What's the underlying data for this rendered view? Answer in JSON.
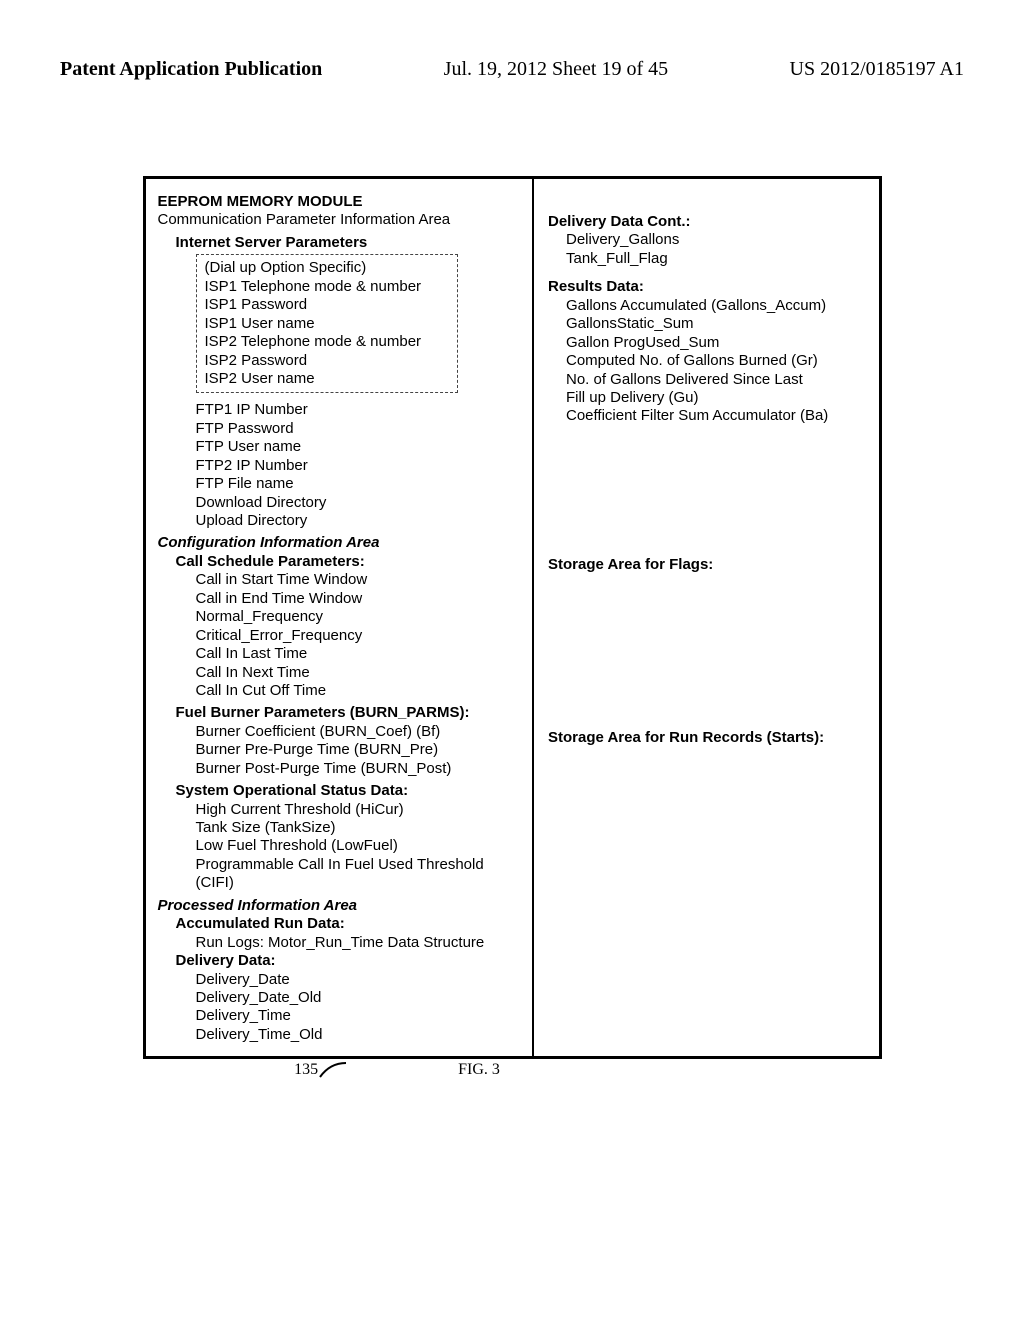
{
  "header": {
    "left": "Patent Application Publication",
    "center": "Jul. 19, 2012  Sheet 19 of 45",
    "right": "US 2012/0185197 A1"
  },
  "left": {
    "title": "EEPROM MEMORY MODULE",
    "commArea": "Communication Parameter Information Area",
    "ispHeading": "Internet Server Parameters",
    "dialup": [
      "(Dial up Option Specific)",
      "ISP1 Telephone mode & number",
      "ISP1 Password",
      "ISP1 User name",
      "ISP2 Telephone mode & number",
      "ISP2 Password",
      "ISP2 User name"
    ],
    "ftp": [
      "FTP1 IP Number",
      "FTP Password",
      "FTP User name",
      "FTP2 IP Number",
      "FTP File name",
      "Download Directory",
      "Upload Directory"
    ],
    "configArea": "Configuration Information Area",
    "callSched": "Call Schedule Parameters:",
    "callItems": [
      "Call in Start Time Window",
      "Call in End Time Window",
      "Normal_Frequency",
      "Critical_Error_Frequency",
      "Call In Last Time",
      "Call In Next Time",
      "Call In Cut Off Time"
    ],
    "burnParms": "Fuel Burner Parameters (BURN_PARMS):",
    "burnItems": [
      "Burner Coefficient (BURN_Coef) (Bf)",
      "Burner Pre-Purge Time (BURN_Pre)",
      "Burner Post-Purge Time (BURN_Post)"
    ],
    "sysOp": "System Operational Status Data:",
    "sysItems": [
      "High Current Threshold (HiCur)",
      "Tank Size (TankSize)",
      "Low Fuel Threshold (LowFuel)",
      "Programmable Call In Fuel Used Threshold (CIFI)"
    ],
    "procArea": "Processed Information Area",
    "accRun": "Accumulated Run Data:",
    "accItems": [
      "Run Logs: Motor_Run_Time Data Structure"
    ],
    "delivery": "Delivery Data:",
    "deliveryItems": [
      "Delivery_Date",
      "Delivery_Date_Old",
      "Delivery_Time",
      "Delivery_Time_Old"
    ]
  },
  "right": {
    "deliveryCont": "Delivery Data Cont.:",
    "deliveryContItems": [
      "Delivery_Gallons",
      "Tank_Full_Flag"
    ],
    "resultsData": "Results Data:",
    "resultsItems": [
      "Gallons Accumulated (Gallons_Accum)",
      "GallonsStatic_Sum",
      "Gallon ProgUsed_Sum",
      "Computed No. of Gallons Burned (Gr)",
      "No. of Gallons Delivered Since Last",
      " Fill up Delivery (Gu)",
      "Coefficient Filter Sum Accumulator (Ba)"
    ],
    "storageFlags": "Storage Area for Flags:",
    "storageRun": "Storage Area for Run Records (Starts):"
  },
  "caption": {
    "ref": "135",
    "fig": "FIG. 3"
  }
}
